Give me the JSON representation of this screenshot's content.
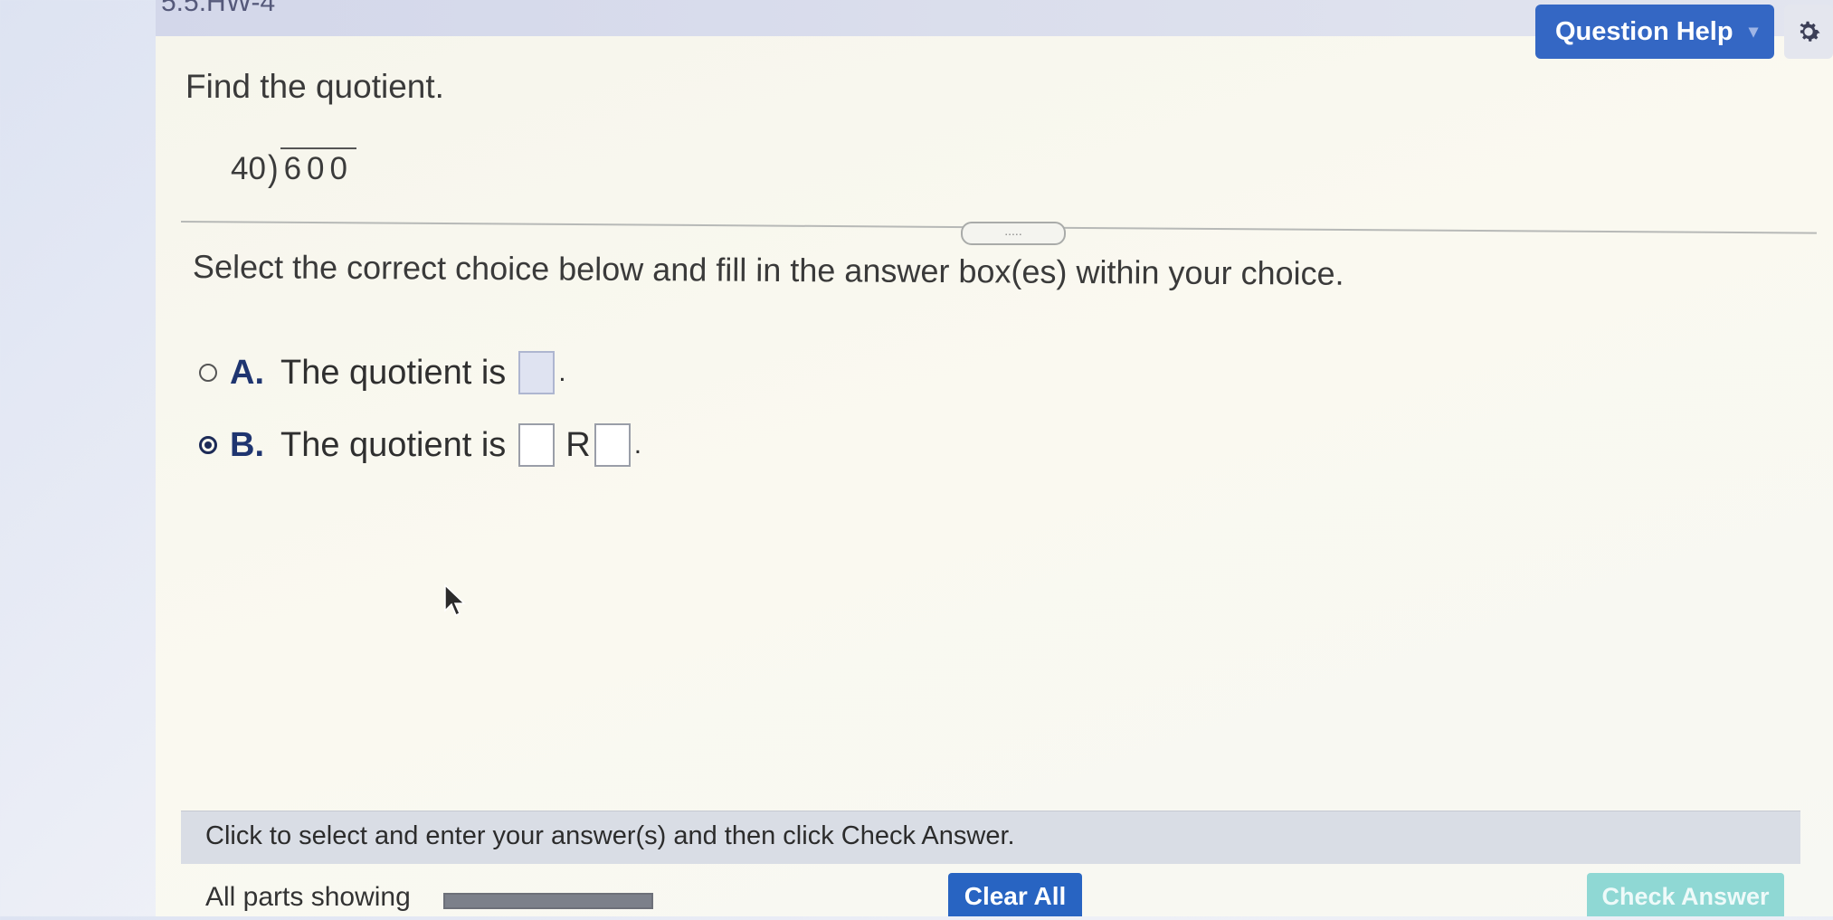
{
  "header": {
    "assignment_title": "5.5.HW-4",
    "question_help_label": "Question Help",
    "question_help_caret": "▾",
    "gear_icon": "gear-icon"
  },
  "question": {
    "prompt": "Find the quotient.",
    "divisor": "40",
    "dividend": "600"
  },
  "divider_handle": ".....",
  "instruction": "Select the correct choice below and fill in the answer box(es) within your choice.",
  "choices": [
    {
      "letter": "A.",
      "text": "The quotient is",
      "suffix": ".",
      "selected": false
    },
    {
      "letter": "B.",
      "text": "The quotient is",
      "remainder_label": "R",
      "suffix": ".",
      "selected": true
    }
  ],
  "footer": {
    "hint": "Click to select and enter your answer(s) and then click Check Answer.",
    "parts_label": "All parts showing",
    "progress": 1.0,
    "clear_label": "Clear All",
    "check_label": "Check Answer"
  },
  "colors": {
    "primary_button": "#2864c2",
    "check_button": "#8fd8d4",
    "question_help": "#3467c4"
  }
}
